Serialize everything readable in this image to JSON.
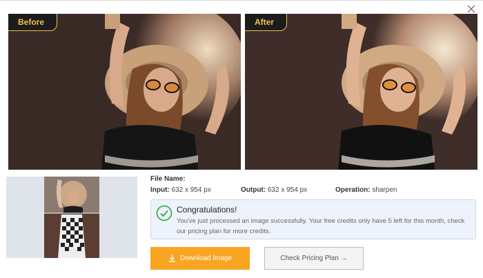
{
  "labels": {
    "before": "Before",
    "after": "After"
  },
  "info": {
    "file_name_label": "File Name:",
    "input_label": "Input:",
    "input_value": "632 x 954 px",
    "output_label": "Output:",
    "output_value": "632 x 954 px",
    "operation_label": "Operation:",
    "operation_value": "sharpen"
  },
  "alert": {
    "title": "Congratulations!",
    "text": "You've just processed an image successfully. Your free credits only have 5 left for this month, check our pricing plan for more credits."
  },
  "buttons": {
    "download": "Download Image",
    "pricing": "Check Pricing Plan →"
  },
  "colors": {
    "accent": "#f8a522",
    "tag_text": "#f2c24a",
    "success": "#3fae4a"
  }
}
